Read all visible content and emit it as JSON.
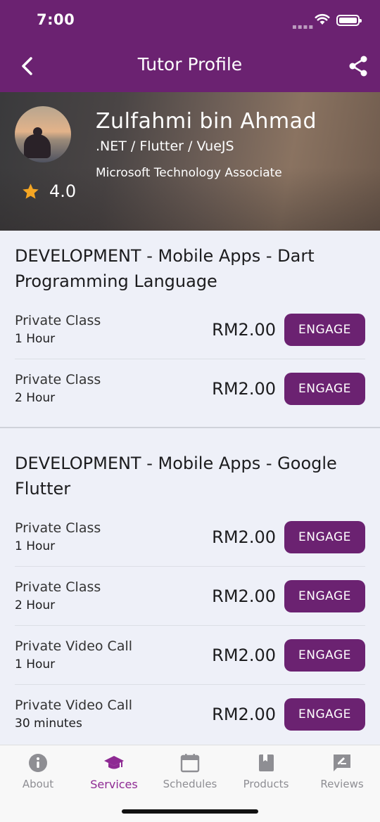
{
  "status": {
    "time": "7:00"
  },
  "nav": {
    "title": "Tutor Profile"
  },
  "tutor": {
    "name": "Zulfahmi bin Ahmad",
    "skills": ".NET / Flutter / VueJS",
    "certification": "Microsoft Technology Associate",
    "rating": "4.0"
  },
  "sections": [
    {
      "title": "DEVELOPMENT - Mobile Apps - Dart Programming Language",
      "items": [
        {
          "class": "Private Class",
          "duration": "1 Hour",
          "price": "RM2.00",
          "action": "ENGAGE"
        },
        {
          "class": "Private Class",
          "duration": "2 Hour",
          "price": "RM2.00",
          "action": "ENGAGE"
        }
      ]
    },
    {
      "title": "DEVELOPMENT - Mobile Apps - Google Flutter",
      "items": [
        {
          "class": "Private Class",
          "duration": "1 Hour",
          "price": "RM2.00",
          "action": "ENGAGE"
        },
        {
          "class": "Private Class",
          "duration": "2 Hour",
          "price": "RM2.00",
          "action": "ENGAGE"
        },
        {
          "class": "Private Video Call",
          "duration": "1 Hour",
          "price": "RM2.00",
          "action": "ENGAGE"
        },
        {
          "class": "Private Video Call",
          "duration": "30 minutes",
          "price": "RM2.00",
          "action": "ENGAGE"
        }
      ]
    }
  ],
  "tabs": [
    {
      "label": "About",
      "icon": "info-icon"
    },
    {
      "label": "Services",
      "icon": "graduation-cap-icon",
      "active": true
    },
    {
      "label": "Schedules",
      "icon": "calendar-icon"
    },
    {
      "label": "Products",
      "icon": "book-icon"
    },
    {
      "label": "Reviews",
      "icon": "rate-review-icon"
    }
  ],
  "colors": {
    "primary": "#6b2271",
    "active_tab": "#8e2a93",
    "star": "#f5a623"
  }
}
